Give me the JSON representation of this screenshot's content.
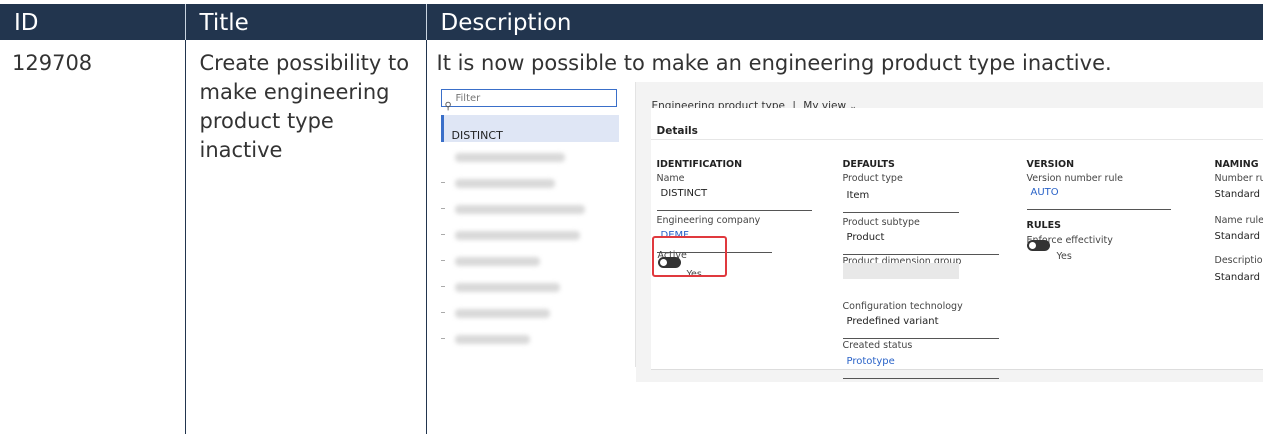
{
  "columns": [
    "ID",
    "Title",
    "Description"
  ],
  "row": {
    "id": "129708",
    "title": "Create possibility to make engineering product type inactive",
    "description": "It is now possible to make an engineering product type inactive."
  },
  "screenshot": {
    "filter_placeholder": "Filter",
    "list_selected": "DISTINCT",
    "header_title": "Engineering product type",
    "header_separator": "|",
    "header_view": "My view",
    "details_label": "Details",
    "identification": {
      "heading": "IDENTIFICATION",
      "name_label": "Name",
      "name_value": "DISTINCT",
      "company_label": "Engineering company",
      "company_value": "DEMF",
      "active_label": "Active",
      "active_value": "Yes"
    },
    "defaults": {
      "heading": "DEFAULTS",
      "product_type_label": "Product type",
      "product_type_value": "Item",
      "product_subtype_label": "Product subtype",
      "product_subtype_value": "Product",
      "dimension_group_label": "Product dimension group",
      "dimension_group_value": "",
      "config_tech_label": "Configuration technology",
      "config_tech_value": "Predefined variant",
      "created_status_label": "Created status",
      "created_status_value": "Prototype"
    },
    "version": {
      "heading": "VERSION",
      "version_rule_label": "Version number rule",
      "version_rule_value": "AUTO",
      "rules_heading": "RULES",
      "effectivity_label": "Enforce effectivity",
      "effectivity_value": "Yes"
    },
    "naming": {
      "heading": "NAMING",
      "number_rule_label": "Number rul",
      "number_rule_value": "Standard",
      "name_rule_label": "Name rule",
      "name_rule_value": "Standard",
      "description_label": "Description",
      "description_value": "Standard"
    }
  },
  "colors": {
    "header_bg": "#22354e",
    "accent": "#3a6fc9",
    "link": "#2a63c8",
    "highlight_box": "#e0393e"
  }
}
